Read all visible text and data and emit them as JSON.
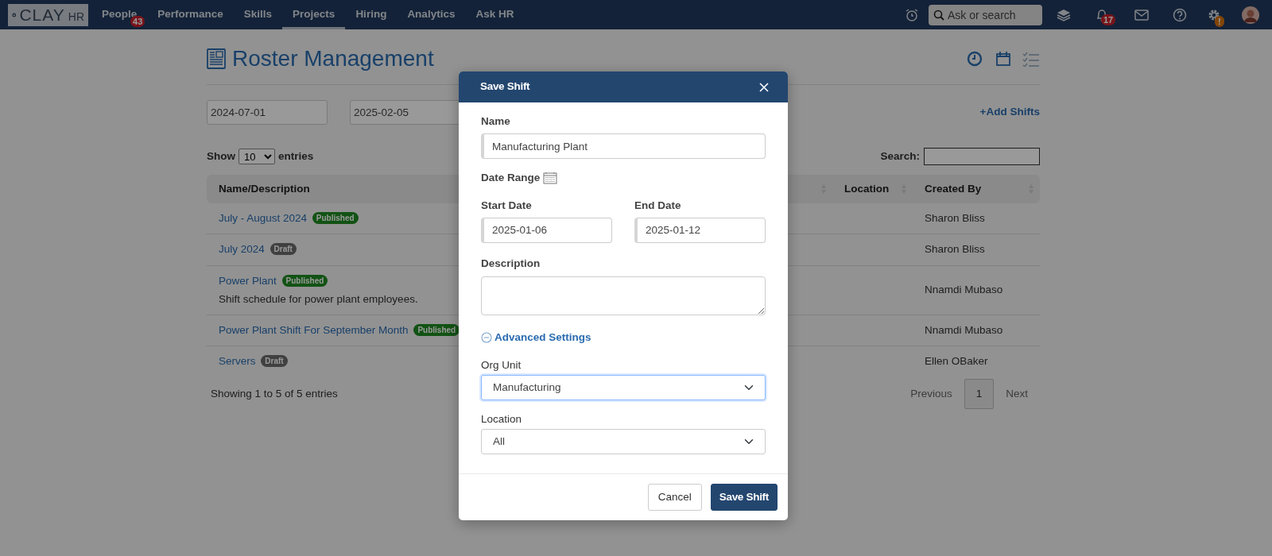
{
  "navbar": {
    "logo": {
      "text": "CLAY",
      "suffix": "HR"
    },
    "items": [
      {
        "label": "People",
        "selected": false,
        "badge": "43"
      },
      {
        "label": "Performance",
        "selected": false
      },
      {
        "label": "Skills",
        "selected": false
      },
      {
        "label": "Projects",
        "selected": true
      },
      {
        "label": "Hiring",
        "selected": false
      },
      {
        "label": "Analytics",
        "selected": false
      },
      {
        "label": "Ask HR",
        "selected": false
      }
    ],
    "search": {
      "placeholder": "Ask or search"
    },
    "notifications_badge": "17",
    "settings_badge": "!"
  },
  "page": {
    "title": "Roster Management",
    "date_filters": [
      "2024-07-01",
      "2025-02-05"
    ],
    "add_link": "+Add Shifts",
    "length": {
      "prefix": "Show",
      "value": "10",
      "suffix": "entries"
    },
    "search_label": "Search:",
    "table": {
      "columns": [
        {
          "label": "Name/Description",
          "sortable": false
        },
        {
          "sortable": true
        },
        {
          "label": "Location",
          "sortable": true
        },
        {
          "label": "Created By",
          "sortable": true
        }
      ],
      "rows": [
        {
          "name": "July - August 2024",
          "status": {
            "label": "Published",
            "kind": "published"
          },
          "created_by": "Sharon Bliss"
        },
        {
          "name": "July 2024",
          "status": {
            "label": "Draft",
            "kind": "draft"
          },
          "created_by": "Sharon Bliss"
        },
        {
          "name": "Power Plant",
          "status": {
            "label": "Published",
            "kind": "published"
          },
          "description": "Shift schedule for power plant employees.",
          "created_by": "Nnamdi Mubaso"
        },
        {
          "name": "Power Plant Shift For September Month",
          "status": {
            "label": "Published",
            "kind": "published"
          },
          "created_by": "Nnamdi Mubaso"
        },
        {
          "name": "Servers",
          "status": {
            "label": "Draft",
            "kind": "draft"
          },
          "created_by": "Ellen OBaker"
        }
      ]
    },
    "info": "Showing 1 to 5 of 5 entries",
    "pagination": [
      {
        "label": "Previous",
        "selected": false
      },
      {
        "label": "1",
        "selected": true
      },
      {
        "label": "Next",
        "selected": false
      }
    ]
  },
  "modal": {
    "title": "Save Shift",
    "name": {
      "label": "Name",
      "value": "Manufacturing Plant"
    },
    "date_range_label": "Date Range",
    "start_date": {
      "label": "Start Date",
      "value": "2025-01-06"
    },
    "end_date": {
      "label": "End Date",
      "value": "2025-01-12"
    },
    "description": {
      "label": "Description"
    },
    "advanced": {
      "label": "Advanced Settings",
      "expanded": true
    },
    "org_unit": {
      "label": "Org Unit",
      "value": "Manufacturing",
      "focused": true
    },
    "location": {
      "label": "Location",
      "value": "All",
      "focused": false
    },
    "buttons": [
      {
        "label": "Cancel",
        "kind": "secondary"
      },
      {
        "label": "Save Shift",
        "kind": "primary"
      }
    ]
  }
}
